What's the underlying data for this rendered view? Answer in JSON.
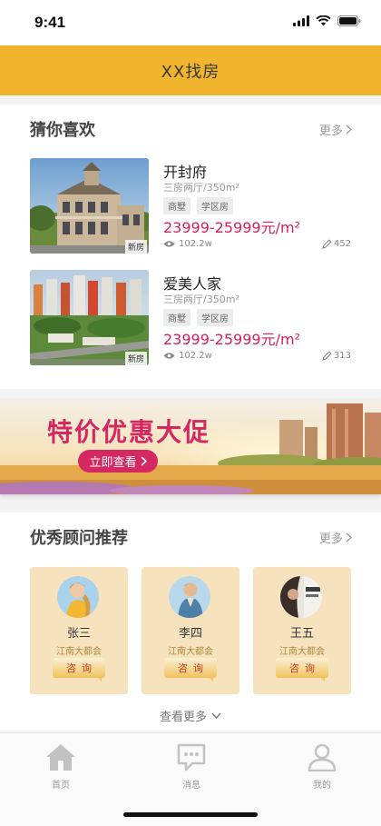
{
  "status": {
    "time": "9:41"
  },
  "nav": {
    "title": "XX找房"
  },
  "guess": {
    "title": "猜你喜欢",
    "more": "更多",
    "houses": [
      {
        "name": "开封府",
        "layout": "三房两厅/350m²",
        "tags": [
          "商墅",
          "学区房"
        ],
        "price": "23999-25999元/m²",
        "views": "102.2w",
        "edits": "452",
        "img_tag": "新房"
      },
      {
        "name": "爱美人家",
        "layout": "三房两厅/350m²",
        "tags": [
          "商墅",
          "学区房"
        ],
        "price": "23999-25999元/m²",
        "views": "102.2w",
        "edits": "313",
        "img_tag": "新房"
      }
    ]
  },
  "banner": {
    "title": "特价优惠大促",
    "button": "立即查看"
  },
  "advisors": {
    "title": "优秀顾问推荐",
    "more": "更多",
    "items": [
      {
        "name": "张三",
        "area": "江南大都会",
        "button": "咨询"
      },
      {
        "name": "李四",
        "area": "江南大都会",
        "button": "咨询"
      },
      {
        "name": "王五",
        "area": "江南大都会",
        "button": "咨询"
      }
    ],
    "see_more": "查看更多"
  },
  "tabs": [
    {
      "label": "首页",
      "icon": "home-icon"
    },
    {
      "label": "消息",
      "icon": "message-icon"
    },
    {
      "label": "我的",
      "icon": "user-icon"
    }
  ],
  "colors": {
    "accent": "#f0b52c",
    "price": "#d6215b",
    "banner_text": "#d42863",
    "advisor_card": "#f6e3bd"
  }
}
